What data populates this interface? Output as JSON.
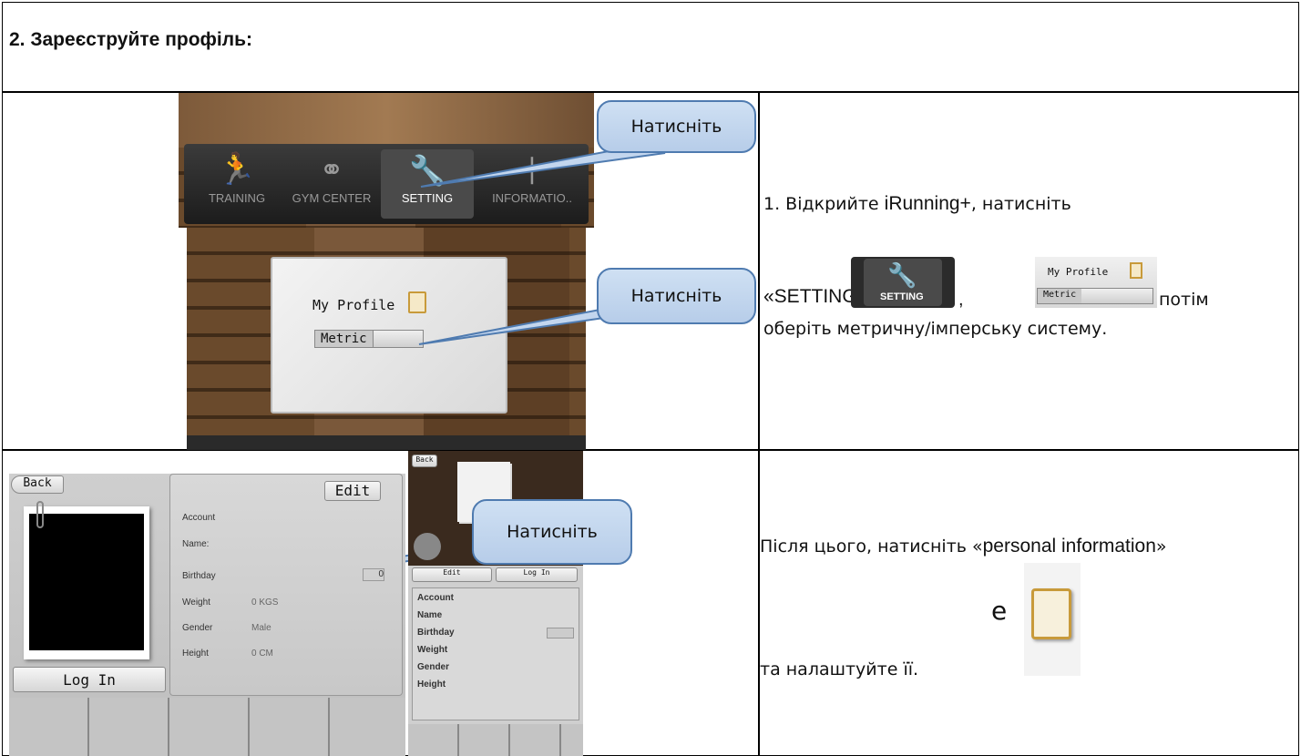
{
  "heading": "2. Зареєструйте профіль:",
  "callout_label": "Натисніть",
  "top_screen": {
    "tabs": [
      "TRAINING",
      "GYM CENTER",
      "SETTING",
      "INFORMATIO.."
    ],
    "my_profile": "My Profile",
    "metric": "Metric"
  },
  "step1": {
    "part1": "1. Відкрийте ",
    "app": "iRunning+",
    "part2": ", натисніть",
    "setting_quote": "«SETTING»",
    "comma": ",",
    "then": "потім",
    "line2": "оберіть метричну/імперську систему.",
    "thumb_setting": "SETTING",
    "thumb_profile": "My Profile",
    "thumb_metric": "Metric"
  },
  "profile_screen": {
    "back": "Back",
    "edit": "Edit",
    "login": "Log In",
    "rows": [
      {
        "label": "Account",
        "value": ""
      },
      {
        "label": "Name:",
        "value": ""
      },
      {
        "label": "Birthday",
        "value": "0"
      },
      {
        "label": "Weight",
        "value": "0 KGS"
      },
      {
        "label": "Gender",
        "value": "Male"
      },
      {
        "label": "Height",
        "value": "0 CM"
      }
    ]
  },
  "small_screen": {
    "back": "Back",
    "edit": "Edit",
    "login": "Log In",
    "rows": [
      "Account",
      "Name",
      "Birthday",
      "Weight",
      "Gender",
      "Height"
    ]
  },
  "step2": {
    "line1a": "Після цього, натисніть «",
    "line1b": "personal information",
    "line1c": "»",
    "e": "е",
    "line2": "та налаштуйте її."
  }
}
